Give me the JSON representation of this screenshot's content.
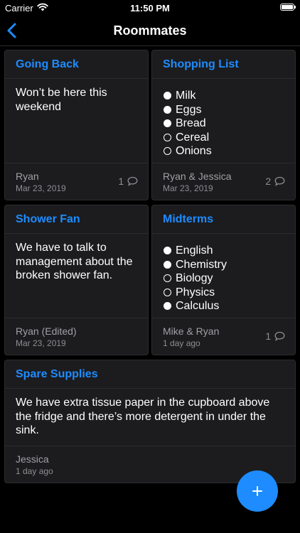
{
  "status": {
    "carrier": "Carrier",
    "time": "11:50 PM"
  },
  "nav": {
    "title": "Roommates"
  },
  "cards": [
    {
      "title": "Going Back",
      "body": "Won’t be here this weekend",
      "author": "Ryan",
      "date": "Mar 23, 2019",
      "comments": "1"
    },
    {
      "title": "Shopping List",
      "items": [
        {
          "text": "Milk",
          "checked": true
        },
        {
          "text": "Eggs",
          "checked": true
        },
        {
          "text": "Bread",
          "checked": true
        },
        {
          "text": "Cereal",
          "checked": false
        },
        {
          "text": "Onions",
          "checked": false
        }
      ],
      "author": "Ryan & Jessica",
      "date": "Mar 23, 2019",
      "comments": "2"
    },
    {
      "title": "Shower Fan",
      "body": "We have to talk to management about the broken shower fan.",
      "author": "Ryan (Edited)",
      "date": "Mar 23, 2019",
      "comments": ""
    },
    {
      "title": "Midterms",
      "items": [
        {
          "text": "English",
          "checked": true
        },
        {
          "text": "Chemistry",
          "checked": true
        },
        {
          "text": "Biology",
          "checked": false
        },
        {
          "text": "Physics",
          "checked": false
        },
        {
          "text": "Calculus",
          "checked": true
        }
      ],
      "author": "Mike & Ryan",
      "date": "1 day ago",
      "comments": "1"
    },
    {
      "title": "Spare Supplies",
      "body": "We have extra tissue paper in the cupboard above the fridge and there’s more detergent in under the sink.",
      "author": "Jessica",
      "date": "1 day ago",
      "comments": ""
    }
  ],
  "colors": {
    "accent": "#1e8cff",
    "background": "#000000",
    "card": "#1c1c1e"
  },
  "icons": {
    "wifi": "wifi-icon",
    "battery": "battery-icon",
    "back": "chevron-left-icon",
    "comment": "speech-bubble-icon",
    "add": "plus-icon"
  }
}
